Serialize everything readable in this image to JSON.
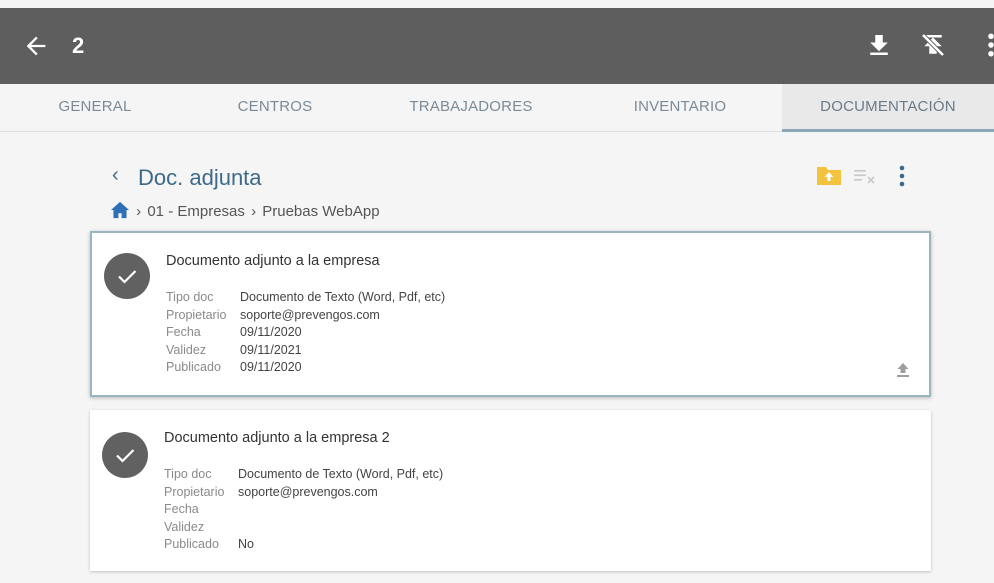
{
  "topbar": {
    "count": "2",
    "bg": "#5e5e5e"
  },
  "tabs": [
    {
      "label": "GENERAL",
      "active": false
    },
    {
      "label": "CENTROS",
      "active": false
    },
    {
      "label": "TRABAJADORES",
      "active": false
    },
    {
      "label": "INVENTARIO",
      "active": false
    },
    {
      "label": "DOCUMENTACIÓN",
      "active": true
    }
  ],
  "section": {
    "title": "Doc. adjunta",
    "breadcrumb": [
      "01 - Empresas",
      "Pruebas WebApp"
    ],
    "folder_color": "#f3c33f"
  },
  "labels": {
    "tipo": "Tipo doc",
    "propietario": "Propietario",
    "fecha": "Fecha",
    "validez": "Validez",
    "publicado": "Publicado"
  },
  "documents": [
    {
      "title": "Documento adjunto a la empresa",
      "tipo": "Documento de Texto (Word, Pdf, etc)",
      "propietario": "soporte@prevengos.com",
      "fecha": "09/11/2020",
      "validez": "09/11/2021",
      "publicado": "09/11/2020",
      "selected": true
    },
    {
      "title": "Documento adjunto a la empresa 2",
      "tipo": "Documento de Texto (Word, Pdf, etc)",
      "propietario": "soporte@prevengos.com",
      "fecha": "",
      "validez": "",
      "publicado": "No",
      "selected": false
    }
  ]
}
